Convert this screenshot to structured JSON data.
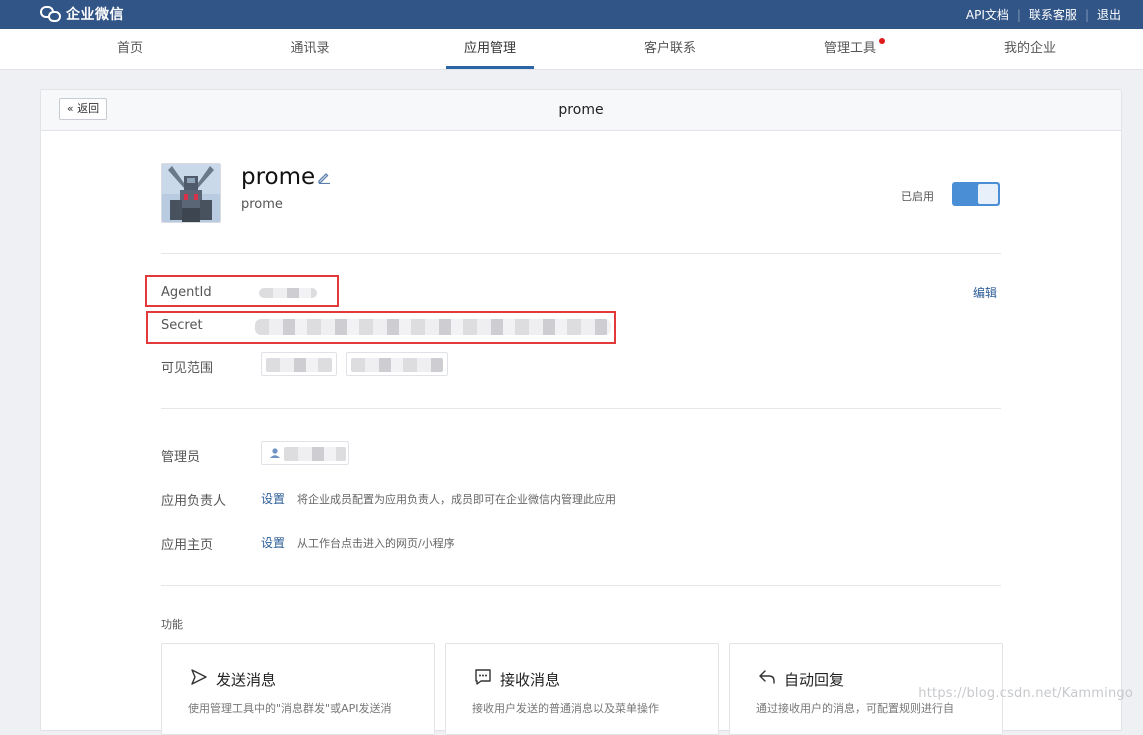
{
  "topbar": {
    "logo_text": "企业微信",
    "links": [
      "API文档",
      "联系客服",
      "退出"
    ],
    "separator": "|"
  },
  "nav": {
    "items": [
      "首页",
      "通讯录",
      "应用管理",
      "客户联系",
      "管理工具",
      "我的企业"
    ],
    "active": "应用管理"
  },
  "panel": {
    "back_label": "返回",
    "title": "prome"
  },
  "app": {
    "name": "prome",
    "subtitle": "prome",
    "status_label": "已启用",
    "enabled": true
  },
  "details": {
    "agentid_label": "AgentId",
    "secret_label": "Secret",
    "visible_label": "可见范围",
    "edit_label": "编辑"
  },
  "roles": {
    "admin_label": "管理员",
    "owner_label": "应用负责人",
    "owner_action": "设置",
    "owner_desc": "将企业成员配置为应用负责人，成员即可在企业微信内管理此应用",
    "home_label": "应用主页",
    "home_action": "设置",
    "home_desc": "从工作台点击进入的网页/小程序"
  },
  "features": {
    "label": "功能",
    "cards": [
      {
        "title": "发送消息",
        "desc": "使用管理工具中的\"消息群发\"或API发送消",
        "icon": "send-icon"
      },
      {
        "title": "接收消息",
        "desc": "接收用户发送的普通消息以及菜单操作",
        "icon": "message-icon"
      },
      {
        "title": "自动回复",
        "desc": "通过接收用户的消息，可配置规则进行自",
        "icon": "reply-icon"
      }
    ]
  },
  "watermark": "https://blog.csdn.net/Kammingo",
  "colors": {
    "topbar": "#315587",
    "accent": "#2c64a8",
    "toggle": "#4a8fd6",
    "highlight": "#e23a3a",
    "notify_dot": "#e01a1a"
  }
}
